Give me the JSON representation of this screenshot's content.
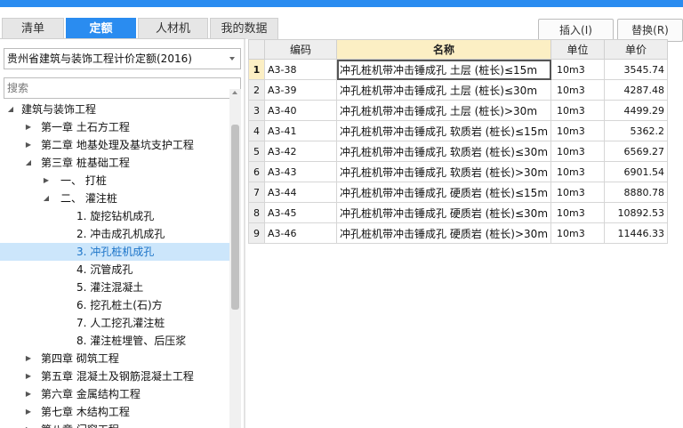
{
  "tabs": [
    {
      "label": "清单",
      "active": false
    },
    {
      "label": "定额",
      "active": true
    },
    {
      "label": "人材机",
      "active": false
    },
    {
      "label": "我的数据",
      "active": false
    }
  ],
  "toolbar": {
    "insert_label": "插入(I)",
    "replace_label": "替换(R)"
  },
  "quota_library": {
    "selected": "贵州省建筑与装饰工程计价定额(2016)"
  },
  "search": {
    "placeholder": "搜索"
  },
  "tree": [
    {
      "label": "建筑与装饰工程",
      "level": 0,
      "caret": "open"
    },
    {
      "label": "第一章  土石方工程",
      "level": 1,
      "caret": "closed"
    },
    {
      "label": "第二章  地基处理及基坑支护工程",
      "level": 1,
      "caret": "closed"
    },
    {
      "label": "第三章  桩基础工程",
      "level": 1,
      "caret": "open"
    },
    {
      "label": "一、  打桩",
      "level": 2,
      "caret": "closed"
    },
    {
      "label": "二、  灌注桩",
      "level": 2,
      "caret": "open"
    },
    {
      "label": "1.  旋挖钻机成孔",
      "level": 3,
      "caret": "none"
    },
    {
      "label": "2.  冲击成孔机成孔",
      "level": 3,
      "caret": "none"
    },
    {
      "label": "3.  冲孔桩机成孔",
      "level": 3,
      "caret": "none",
      "selected": true
    },
    {
      "label": "4.  沉管成孔",
      "level": 3,
      "caret": "none"
    },
    {
      "label": "5.  灌注混凝土",
      "level": 3,
      "caret": "none"
    },
    {
      "label": "6.  挖孔桩土(石)方",
      "level": 3,
      "caret": "none"
    },
    {
      "label": "7.  人工挖孔灌注桩",
      "level": 3,
      "caret": "none"
    },
    {
      "label": "8.  灌注桩埋管、后压浆",
      "level": 3,
      "caret": "none"
    },
    {
      "label": "第四章  砌筑工程",
      "level": 1,
      "caret": "closed"
    },
    {
      "label": "第五章  混凝土及钢筋混凝土工程",
      "level": 1,
      "caret": "closed"
    },
    {
      "label": "第六章  金属结构工程",
      "level": 1,
      "caret": "closed"
    },
    {
      "label": "第七章  木结构工程",
      "level": 1,
      "caret": "closed"
    },
    {
      "label": "第八章  门窗工程",
      "level": 1,
      "caret": "closed"
    }
  ],
  "table": {
    "columns": [
      "编码",
      "名称",
      "单位",
      "单价"
    ],
    "rows": [
      {
        "no": "1",
        "code": "A3-38",
        "name": "冲孔桩机带冲击锤成孔 土层 (桩长)≤15m",
        "unit": "10m3",
        "price": "3545.74"
      },
      {
        "no": "2",
        "code": "A3-39",
        "name": "冲孔桩机带冲击锤成孔 土层 (桩长)≤30m",
        "unit": "10m3",
        "price": "4287.48"
      },
      {
        "no": "3",
        "code": "A3-40",
        "name": "冲孔桩机带冲击锤成孔 土层 (桩长)>30m",
        "unit": "10m3",
        "price": "4499.29"
      },
      {
        "no": "4",
        "code": "A3-41",
        "name": "冲孔桩机带冲击锤成孔 软质岩 (桩长)≤15m",
        "unit": "10m3",
        "price": "5362.2"
      },
      {
        "no": "5",
        "code": "A3-42",
        "name": "冲孔桩机带冲击锤成孔 软质岩 (桩长)≤30m",
        "unit": "10m3",
        "price": "6569.27"
      },
      {
        "no": "6",
        "code": "A3-43",
        "name": "冲孔桩机带冲击锤成孔 软质岩 (桩长)>30m",
        "unit": "10m3",
        "price": "6901.54"
      },
      {
        "no": "7",
        "code": "A3-44",
        "name": "冲孔桩机带冲击锤成孔 硬质岩 (桩长)≤15m",
        "unit": "10m3",
        "price": "8880.78"
      },
      {
        "no": "8",
        "code": "A3-45",
        "name": "冲孔桩机带冲击锤成孔 硬质岩 (桩长)≤30m",
        "unit": "10m3",
        "price": "10892.53"
      },
      {
        "no": "9",
        "code": "A3-46",
        "name": "冲孔桩机带冲击锤成孔 硬质岩 (桩长)>30m",
        "unit": "10m3",
        "price": "11446.33"
      }
    ]
  },
  "colors": {
    "accent": "#2a8cf0",
    "header_highlight": "#fcefc4",
    "tree_selection": "#cce6fb"
  }
}
